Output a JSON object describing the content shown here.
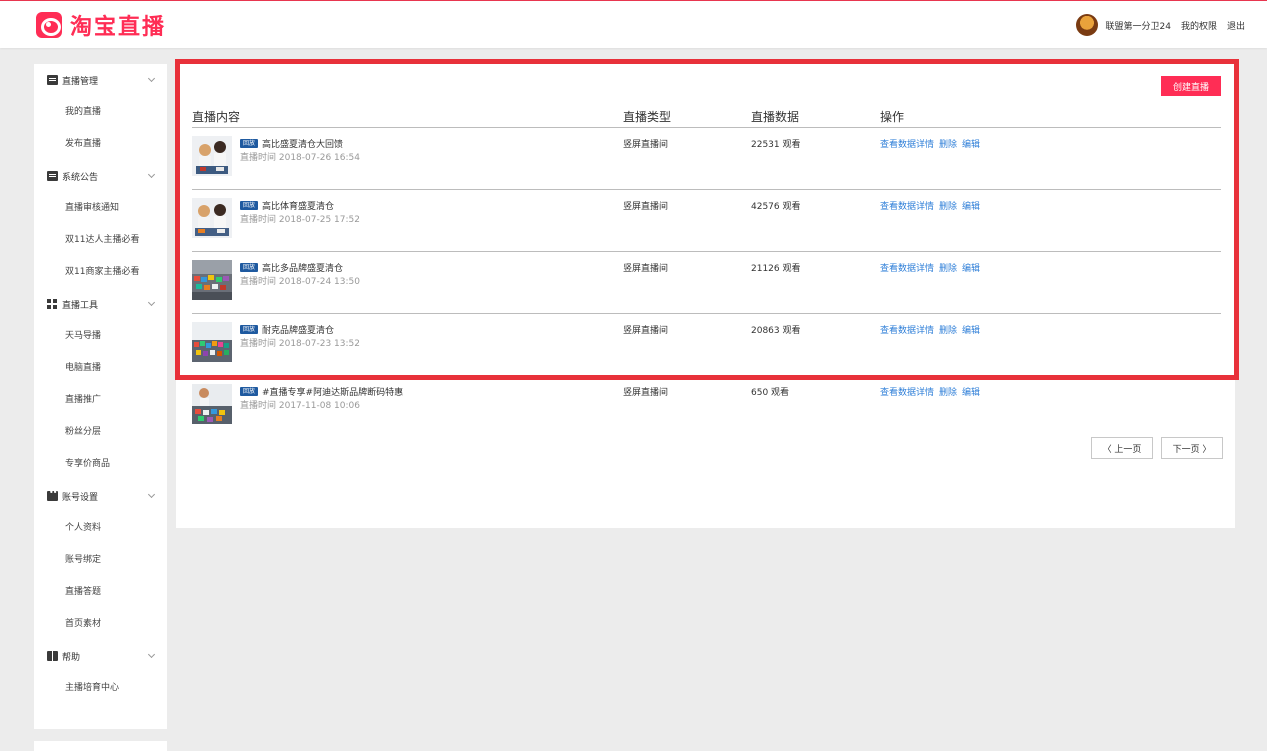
{
  "header": {
    "logo_text": "淘宝直播",
    "username": "联盟第一分卫24",
    "permissions_link": "我的权限",
    "logout_link": "退出"
  },
  "sidebar": {
    "groups": [
      {
        "label": "直播管理",
        "icon": "document-icon",
        "items": [
          "我的直播",
          "发布直播"
        ]
      },
      {
        "label": "系统公告",
        "icon": "document-icon",
        "items": [
          "直播审核通知",
          "双11达人主播必看",
          "双11商家主播必看"
        ]
      },
      {
        "label": "直播工具",
        "icon": "grid-icon",
        "items": [
          "天马导播",
          "电脑直播",
          "直播推广",
          "粉丝分层",
          "专享价商品"
        ]
      },
      {
        "label": "账号设置",
        "icon": "account-icon",
        "items": [
          "个人资料",
          "账号绑定",
          "直播答题",
          "首页素材"
        ]
      },
      {
        "label": "帮助",
        "icon": "book-icon",
        "items": [
          "主播培育中心"
        ]
      }
    ]
  },
  "main": {
    "create_button": "创建直播",
    "columns": {
      "content": "直播内容",
      "type": "直播类型",
      "data": "直播数据",
      "actions": "操作"
    },
    "tag_label": "回放",
    "rows": [
      {
        "title": "高比盛夏清仓大回馈",
        "time": "直播时间 2018-07-26 16:54",
        "type": "竖屏直播间",
        "views": "22531 观看"
      },
      {
        "title": "高比体育盛夏清仓",
        "time": "直播时间 2018-07-25 17:52",
        "type": "竖屏直播间",
        "views": "42576 观看"
      },
      {
        "title": "高比多品牌盛夏清仓",
        "time": "直播时间 2018-07-24 13:50",
        "type": "竖屏直播间",
        "views": "21126 观看"
      },
      {
        "title": "耐克品牌盛夏清仓",
        "time": "直播时间 2018-07-23 13:52",
        "type": "竖屏直播间",
        "views": "20863 观看"
      },
      {
        "title": "#直播专享#阿迪达斯品牌断码特惠",
        "time": "直播时间 2017-11-08 10:06",
        "type": "竖屏直播间",
        "views": "650 观看"
      }
    ],
    "actions": {
      "details": "查看数据详情",
      "delete": "删除",
      "edit": "编辑"
    },
    "pagination": {
      "prev": "〈 上一页",
      "next": "下一页 〉"
    }
  },
  "colors": {
    "brand": "#ff2d55",
    "link": "#2f7fd8",
    "highlight_border": "#e8313a",
    "tag": "#1f5aa0"
  }
}
